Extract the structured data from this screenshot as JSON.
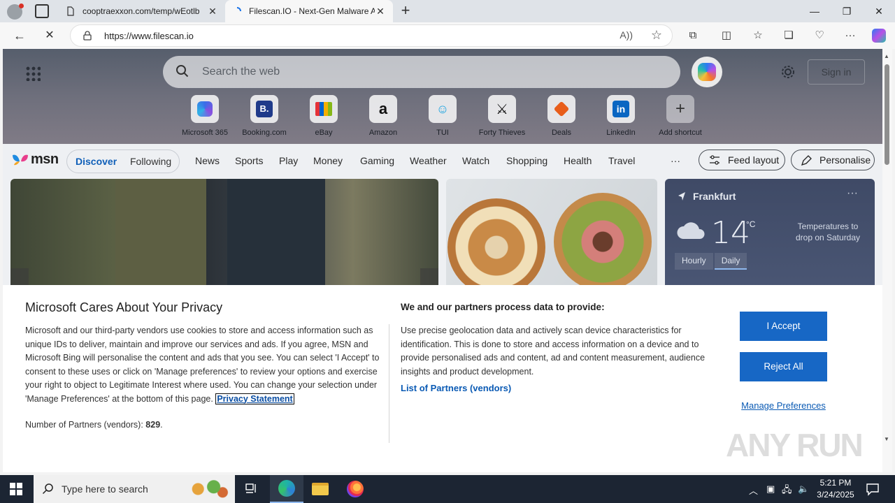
{
  "browser": {
    "tabs": [
      {
        "title": "cooptraexxon.com/temp/wEotlb",
        "active": false
      },
      {
        "title": "Filescan.IO - Next-Gen Malware A",
        "active": true
      }
    ],
    "new_tab": "+",
    "window_controls": {
      "minimize": "—",
      "restore": "❐",
      "close": "✕"
    },
    "url": "https://www.filescan.io",
    "back": "←",
    "stop": "✕"
  },
  "newtab_page": {
    "search_placeholder": "Search the web",
    "sign_in": "Sign in",
    "shortcuts": [
      {
        "label": "Microsoft 365",
        "icon": "microsoft-365-icon"
      },
      {
        "label": "Booking.com",
        "icon": "booking-icon"
      },
      {
        "label": "eBay",
        "icon": "ebay-icon"
      },
      {
        "label": "Amazon",
        "icon": "amazon-icon"
      },
      {
        "label": "TUI",
        "icon": "tui-icon"
      },
      {
        "label": "Forty Thieves",
        "icon": "forty-thieves-icon"
      },
      {
        "label": "Deals",
        "icon": "deals-icon"
      },
      {
        "label": "LinkedIn",
        "icon": "linkedin-icon"
      },
      {
        "label": "Add shortcut",
        "icon": "plus-icon"
      }
    ]
  },
  "msn": {
    "logo": "msn",
    "discover": "Discover",
    "following": "Following",
    "nav": [
      "News",
      "Sports",
      "Play",
      "Money",
      "Gaming",
      "Weather",
      "Watch",
      "Shopping",
      "Health",
      "Travel"
    ],
    "more": "···",
    "feed_layout": "Feed layout",
    "personalise": "Personalise"
  },
  "weather": {
    "city": "Frankfurt",
    "temp": "14",
    "unit": "°C",
    "forecast": "Temperatures to drop on Saturday",
    "tabs": [
      "Hourly",
      "Daily"
    ],
    "more": "···"
  },
  "privacy": {
    "title": "Microsoft Cares About Your Privacy",
    "body": "Microsoft and our third-party vendors use cookies to store and access information such as unique IDs to deliver, maintain and improve our services and ads. If you agree, MSN and Microsoft Bing will personalise the content and ads that you see. You can select 'I Accept' to consent to these uses or click on 'Manage preferences' to review your options and exercise your right to object to Legitimate Interest where used.  You can change your selection under 'Manage Preferences' at the bottom of this page.",
    "privacy_link": "Privacy Statement",
    "partners_count_label": "Number of Partners (vendors):",
    "partners_count": "829",
    "partners_dot": ".",
    "right_title": "We and our partners process data to provide:",
    "right_body": "Use precise geolocation data and actively scan device characteristics for identification. This is done to store and access information on a device and to provide personalised ads and content, ad and content measurement, audience insights and product development.",
    "partners_link": "List of Partners (vendors)",
    "accept": "I Accept",
    "reject": "Reject All",
    "manage": "Manage Preferences"
  },
  "watermark": "ANY RUN",
  "taskbar": {
    "search_placeholder": "Type here to search",
    "time": "5:21 PM",
    "date": "3/24/2025"
  },
  "colors": {
    "accent_blue": "#1767c5",
    "link_blue": "#0a5ab4",
    "taskbar": "#1c2533"
  }
}
